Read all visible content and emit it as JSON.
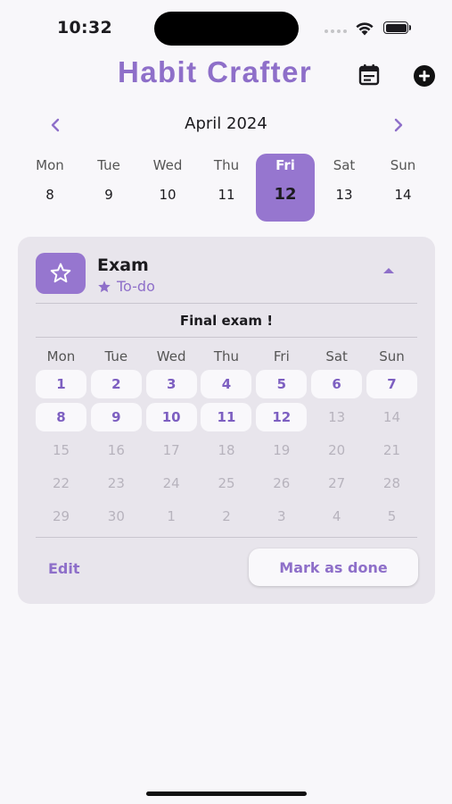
{
  "status_bar": {
    "time": "10:32"
  },
  "header": {
    "title": "Habit Crafter",
    "calendar_icon": "calendar-icon",
    "add_icon": "plus-circle-icon"
  },
  "month_nav": {
    "label": "April 2024"
  },
  "week": [
    {
      "name": "Mon",
      "num": "8",
      "selected": false
    },
    {
      "name": "Tue",
      "num": "9",
      "selected": false
    },
    {
      "name": "Wed",
      "num": "10",
      "selected": false
    },
    {
      "name": "Thu",
      "num": "11",
      "selected": false
    },
    {
      "name": "Fri",
      "num": "12",
      "selected": true
    },
    {
      "name": "Sat",
      "num": "13",
      "selected": false
    },
    {
      "name": "Sun",
      "num": "14",
      "selected": false
    }
  ],
  "habit": {
    "name": "Exam",
    "status": "To-do",
    "description": "Final exam !",
    "icon": "star-icon",
    "weekday_headers": [
      "Mon",
      "Tue",
      "Wed",
      "Thu",
      "Fri",
      "Sat",
      "Sun"
    ],
    "rows": [
      [
        {
          "d": "1",
          "done": true
        },
        {
          "d": "2",
          "done": true
        },
        {
          "d": "3",
          "done": true
        },
        {
          "d": "4",
          "done": true
        },
        {
          "d": "5",
          "done": true
        },
        {
          "d": "6",
          "done": true
        },
        {
          "d": "7",
          "done": true
        }
      ],
      [
        {
          "d": "8",
          "done": true
        },
        {
          "d": "9",
          "done": true
        },
        {
          "d": "10",
          "done": true
        },
        {
          "d": "11",
          "done": true
        },
        {
          "d": "12",
          "done": true
        },
        {
          "d": "13",
          "done": false
        },
        {
          "d": "14",
          "done": false
        }
      ],
      [
        {
          "d": "15",
          "done": false
        },
        {
          "d": "16",
          "done": false
        },
        {
          "d": "17",
          "done": false
        },
        {
          "d": "18",
          "done": false
        },
        {
          "d": "19",
          "done": false
        },
        {
          "d": "20",
          "done": false
        },
        {
          "d": "21",
          "done": false
        }
      ],
      [
        {
          "d": "22",
          "done": false
        },
        {
          "d": "23",
          "done": false
        },
        {
          "d": "24",
          "done": false
        },
        {
          "d": "25",
          "done": false
        },
        {
          "d": "26",
          "done": false
        },
        {
          "d": "27",
          "done": false
        },
        {
          "d": "28",
          "done": false
        }
      ],
      [
        {
          "d": "29",
          "done": false
        },
        {
          "d": "30",
          "done": false
        },
        {
          "d": "1",
          "done": false
        },
        {
          "d": "2",
          "done": false
        },
        {
          "d": "3",
          "done": false
        },
        {
          "d": "4",
          "done": false
        },
        {
          "d": "5",
          "done": false
        }
      ]
    ],
    "edit_label": "Edit",
    "mark_done_label": "Mark as done"
  },
  "colors": {
    "accent": "#9676cf",
    "accent_text": "#8e6fc9",
    "card": "#e8e5ec",
    "background": "#f8f7fa"
  }
}
